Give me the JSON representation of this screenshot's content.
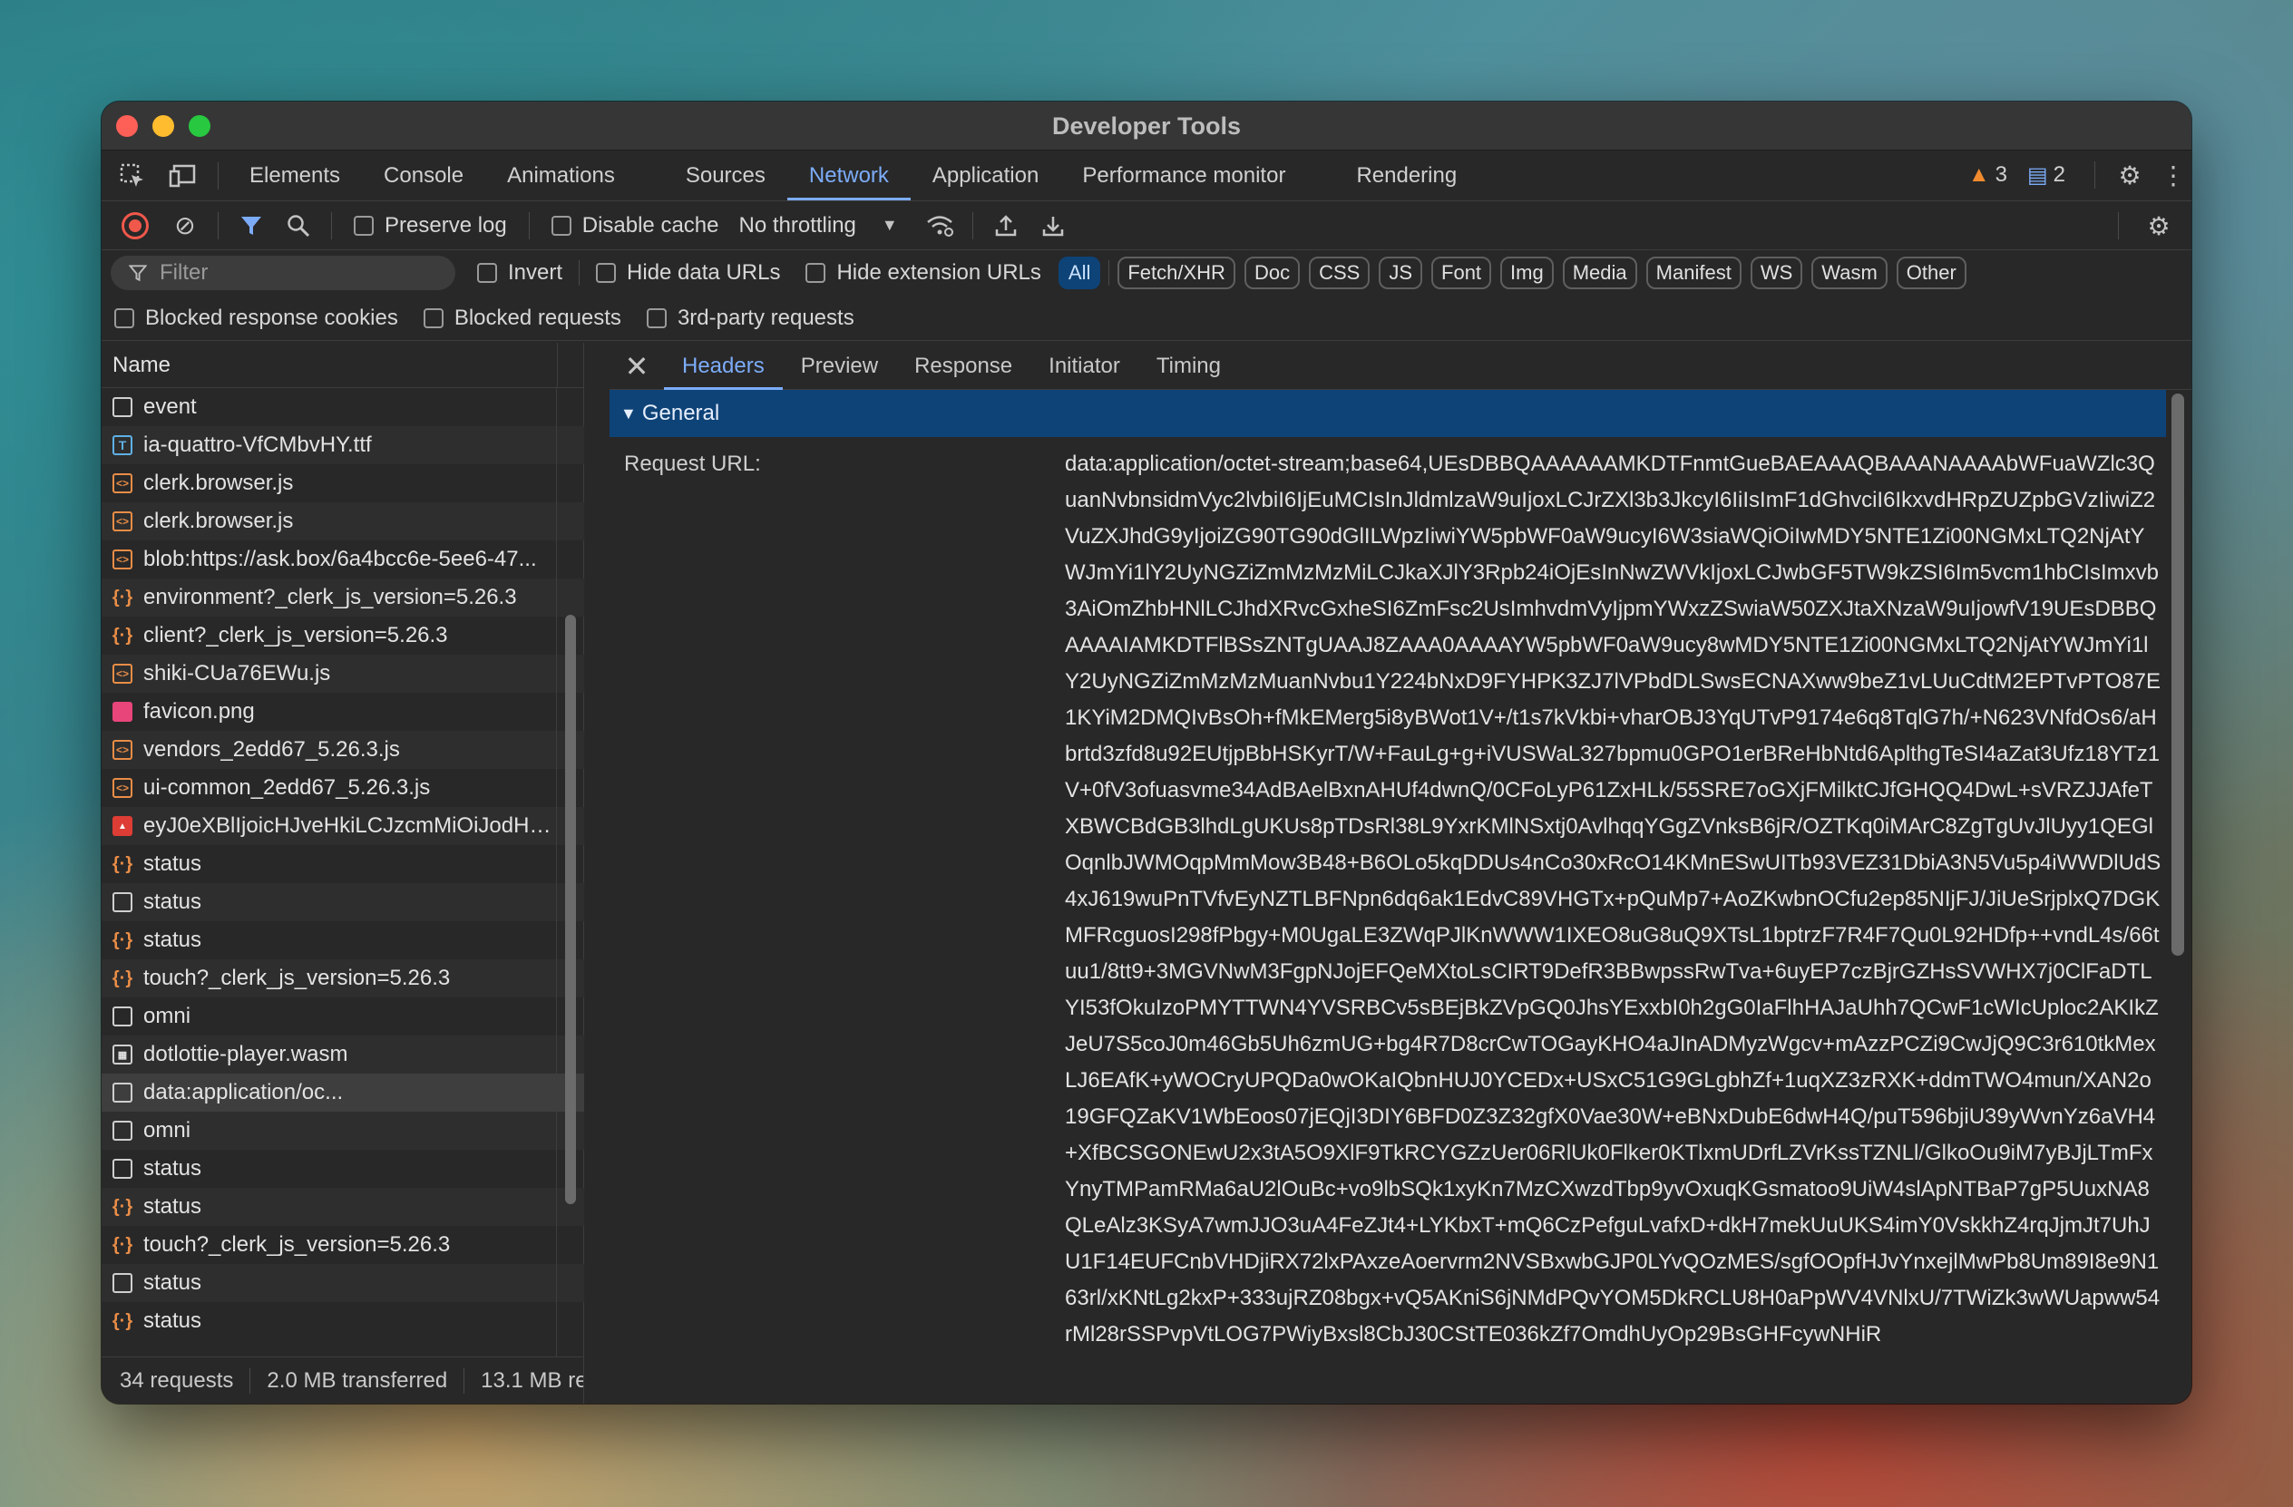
{
  "window": {
    "title": "Developer Tools"
  },
  "main_tabs": [
    "Elements",
    "Console",
    "Animations",
    "Sources",
    "Network",
    "Application",
    "Performance monitor",
    "Rendering"
  ],
  "active_tab": "Network",
  "issues": {
    "warnings": "3",
    "messages": "2"
  },
  "toolbar": {
    "preserve_log": "Preserve log",
    "disable_cache": "Disable cache",
    "throttling": "No throttling"
  },
  "filter": {
    "placeholder": "Filter",
    "invert": "Invert",
    "hide_data_urls": "Hide data URLs",
    "hide_extension_urls": "Hide extension URLs",
    "types": [
      "All",
      "Fetch/XHR",
      "Doc",
      "CSS",
      "JS",
      "Font",
      "Img",
      "Media",
      "Manifest",
      "WS",
      "Wasm",
      "Other"
    ],
    "active_type": "All",
    "blocked_response_cookies": "Blocked response cookies",
    "blocked_requests": "Blocked requests",
    "third_party": "3rd-party requests"
  },
  "requests": {
    "column": "Name",
    "rows": [
      {
        "name": "event",
        "icon": "document-icon"
      },
      {
        "name": "ia-quattro-VfCMbvHY.ttf",
        "icon": "font-icon"
      },
      {
        "name": "clerk.browser.js",
        "icon": "script-icon"
      },
      {
        "name": "clerk.browser.js",
        "icon": "script-icon"
      },
      {
        "name": "blob:https://ask.box/6a4bcc6e-5ee6-47...",
        "icon": "script-icon"
      },
      {
        "name": "environment?_clerk_js_version=5.26.3",
        "icon": "xhr-icon"
      },
      {
        "name": "client?_clerk_js_version=5.26.3",
        "icon": "xhr-icon"
      },
      {
        "name": "shiki-CUa76EWu.js",
        "icon": "script-icon"
      },
      {
        "name": "favicon.png",
        "icon": "image-icon"
      },
      {
        "name": "vendors_2edd67_5.26.3.js",
        "icon": "script-icon"
      },
      {
        "name": "ui-common_2edd67_5.26.3.js",
        "icon": "script-icon"
      },
      {
        "name": "eyJ0eXBlIjoicHJveHkiLCJzcmMiOiJodHR...",
        "icon": "image-red-icon"
      },
      {
        "name": "status",
        "icon": "xhr-icon"
      },
      {
        "name": "status",
        "icon": "blank-icon"
      },
      {
        "name": "status",
        "icon": "xhr-icon"
      },
      {
        "name": "touch?_clerk_js_version=5.26.3",
        "icon": "xhr-icon"
      },
      {
        "name": "omni",
        "icon": "blank-icon"
      },
      {
        "name": "dotlottie-player.wasm",
        "icon": "wasm-icon"
      },
      {
        "name": "data:application/oc...",
        "icon": "blank-icon",
        "selected": true
      },
      {
        "name": "omni",
        "icon": "document-icon"
      },
      {
        "name": "status",
        "icon": "blank-icon"
      },
      {
        "name": "status",
        "icon": "xhr-icon"
      },
      {
        "name": "touch?_clerk_js_version=5.26.3",
        "icon": "xhr-icon"
      },
      {
        "name": "status",
        "icon": "blank-icon"
      },
      {
        "name": "status",
        "icon": "xhr-icon"
      }
    ]
  },
  "status_bar": {
    "requests": "34 requests",
    "transferred": "2.0 MB transferred",
    "resources": "13.1 MB re"
  },
  "detail": {
    "tabs": [
      "Headers",
      "Preview",
      "Response",
      "Initiator",
      "Timing"
    ],
    "active_tab": "Headers",
    "section": "General",
    "request_url_label": "Request URL:",
    "request_url_value": "data:application/octet-stream;base64,UEsDBBQAAAAAAMKDTFnmtGueBAEAAAQBAAANAAAAbWFuaWZlc3QuanNvbnsidmVyc2lvbiI6IjEuMCIsInJldmlzaW9uIjoxLCJrZXl3b3JkcyI6IiIsImF1dGhvciI6IkxvdHRpZUZpbGVzIiwiZ2VuZXJhdG9yIjoiZG90TG90dGlILWpzIiwiYW5pbWF0aW9ucyI6W3siaWQiOiIwMDY5NTE1Zi00NGMxLTQ2NjAtYWJmYi1lY2UyNGZiZmMzMzMiLCJkaXJlY3Rpb24iOjEsInNwZWVkIjoxLCJwbGF5TW9kZSI6Im5vcm1hbCIsImxvb3AiOmZhbHNlLCJhdXRvcGxheSI6ZmFsc2UsImhvdmVyIjpmYWxzZSwiaW50ZXJtaXNzaW9uIjowfV19UEsDBBQAAAAIAMKDTFlBSsZNTgUAAJ8ZAAA0AAAAYW5pbWF0aW9ucy8wMDY5NTE1Zi00NGMxLTQ2NjAtYWJmYi1lY2UyNGZiZmMzMzMuanNvbu1Y224bNxD9FYHPK3ZJ7lVPbdDLSwsECNAXww9beZ1vLUuCdtM2EPTvPTO87E1KYiM2DMQIvBsOh+fMkEMerg5i8yBWot1V+/t1s7kVkbi+vharOBJ3YqUTvP9174e6q8TqlG7h/+N623VNfdOs6/aHbrtd3zfd8u92EUtjpBbHSKyrT/W+FauLg+g+iVUSWaL327bpmu0GPO1erBReHbNtd6AplthgTeSI4aZat3Ufz18YTz1V+0fV3ofuasvme34AdBAelBxnAHUf4dwnQ/0CFoLyP61ZxHLk/55SRE7oGXjFMilktCJfGHQQ4DwL+sVRZJJAfeTXBWCBdGB3lhdLgUKUs8pTDsRl38L9YxrKMlNSxtj0AvlhqqYGgZVnksB6jR/OZTKq0iMArC8ZgTgUvJlUyy1QEGlOqnlbJWMOqpMmMow3B48+B6OLo5kqDDUs4nCo30xRcO14KMnESwUITb93VEZ31DbiA3N5Vu5p4iWWDlUdS4xJ619wuPnTVfvEyNZTLBFNpn6dq6ak1EdvC89VHGTx+pQuMp7+AoZKwbnOCfu2ep85NIjFJ/JiUeSrjplxQ7DGKMFRcguosI298fPbgy+M0UgaLE3ZWqPJlKnWWW1IXEO8uG8uQ9XTsL1bptrzF7R4F7Qu0L92HDfp++vndL4s/66tuu1/8tt9+3MGVNwM3FgpNJojEFQeMXtoLsCIRT9DefR3BBwpssRwTva+6uyEP7czBjrGZHsSVWHX7j0ClFaDTLYI53fOkuIzoPMYTTWN4YVSRBCv5sBEjBkZVpGQ0JhsYExxbI0h2gG0IaFlhHAJaUhh7QCwF1cWIcUploc2AKIkZJeU7S5coJ0m46Gb5Uh6zmUG+bg4R7D8crCwTOGayKHO4aJInADMyzWgcv+mAzzPCZi9CwJjQ9C3r610tkMexLJ6EAfK+yWOCryUPQDa0wOKaIQbnHUJ0YCEDx+USxC51G9GLgbhZf+1uqXZ3zRXK+ddmTWO4mun/XAN2o19GFQZaKV1WbEoos07jEQjI3DIY6BFD0Z3Z32gfX0Vae30W+eBNxDubE6dwH4Q/puT596bjiU39yWvnYz6aVH4+XfBCSGONEwU2x3tA5O9XlF9TkRCYGZzUer06RlUk0Flker0KTlxmUDrfLZVrKssTZNLl/GlkoOu9iM7yBJjLTmFxYnyTMPamRMa6aU2lOuBc+vo9lbSQk1xyKn7MzCXwzdTbp9yvOxuqKGsmatoo9UiW4slApNTBaP7gP5UuxNA8QLeAlz3KSyA7wmJJO3uA4FeZJt4+LYKbxT+mQ6CzPefguLvafxD+dkH7mekUuUKS4imY0VskkhZ4rqJjmJt7UhJU1F14EUFCnbVHDjiRX72lxPAxzeAoervrm2NVSBxwbGJP0LYvQOzMES/sgfOOpfHJvYnxejlMwPb8Um89I8e9N163rl/xKNtLg2kxP+333ujRZ08bgx+vQ5AKniS6jNMdPQvYOM5DkRCLU8H0aPpWV4VNlxU/7TWiZk3wWUapww54rMl28rSSPvpVtLOG7PWiyBxsl8CbJ30CStTE036kZf7OmdhUyOp29BsGHFcywNHiR"
  }
}
